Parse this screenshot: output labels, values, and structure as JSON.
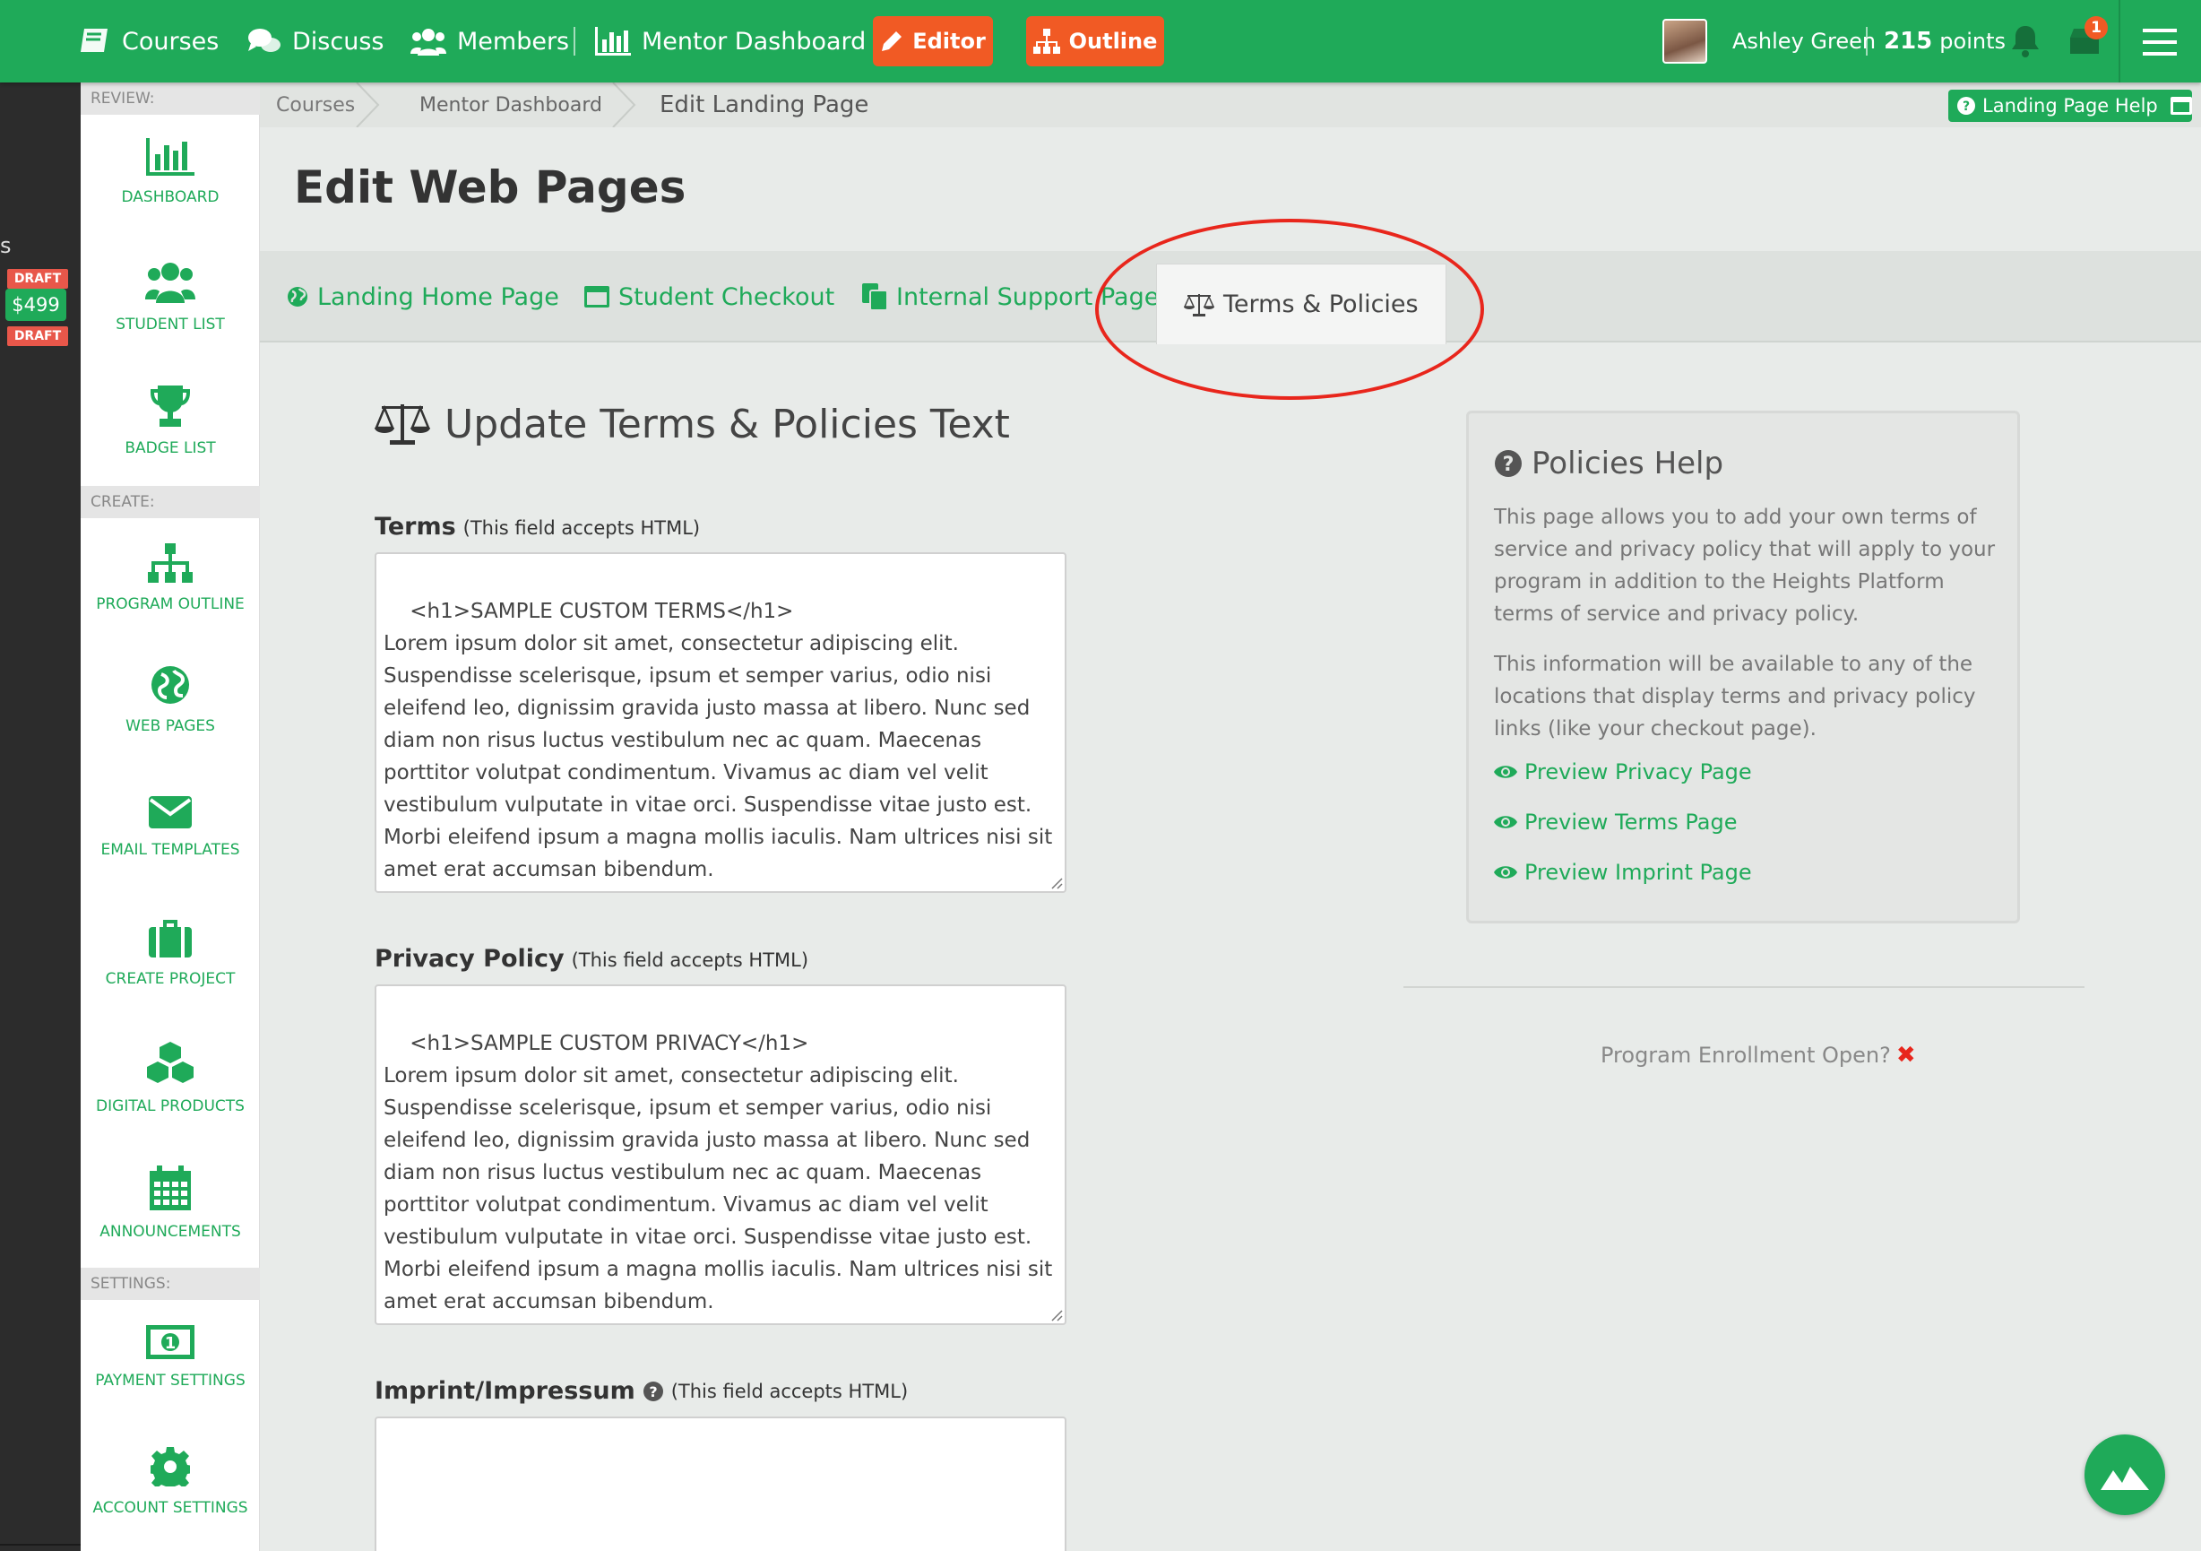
{
  "topnav": {
    "courses": "Courses",
    "discuss": "Discuss",
    "members": "Members",
    "mentor_dashboard": "Mentor Dashboard",
    "editor": "Editor",
    "outline": "Outline",
    "user_name": "Ashley Green",
    "points_value": "215",
    "points_label": "points",
    "notification_count": "1"
  },
  "darkside": {
    "partial_text": "s",
    "price": "$499",
    "draft1": "DRAFT",
    "draft2": "DRAFT"
  },
  "sidebar": {
    "review_heading": "REVIEW:",
    "create_heading": "CREATE:",
    "settings_heading": "SETTINGS:",
    "dashboard": "DASHBOARD",
    "student_list": "STUDENT LIST",
    "badge_list": "BADGE LIST",
    "program_outline": "PROGRAM OUTLINE",
    "web_pages": "WEB PAGES",
    "email_templates": "EMAIL TEMPLATES",
    "create_project": "CREATE PROJECT",
    "digital_products": "DIGITAL PRODUCTS",
    "announcements": "ANNOUNCEMENTS",
    "payment_settings": "PAYMENT SETTINGS",
    "account_settings": "ACCOUNT SETTINGS"
  },
  "breadcrumb": {
    "courses": "Courses",
    "mentor_dashboard": "Mentor Dashboard",
    "current": "Edit Landing Page",
    "help_button": "Landing Page Help"
  },
  "page": {
    "title": "Edit Web Pages"
  },
  "tabs": {
    "landing_home": "Landing Home Page",
    "student_checkout": "Student Checkout",
    "internal_support": "Internal Support Page",
    "terms_policies": "Terms & Policies"
  },
  "form": {
    "section_title": "Update Terms & Policies Text",
    "terms_label": "Terms",
    "privacy_label": "Privacy Policy",
    "imprint_label": "Imprint/Impressum",
    "html_note": "(This field accepts HTML)",
    "terms_value": "<h1>SAMPLE CUSTOM TERMS</h1>\nLorem ipsum dolor sit amet, consectetur adipiscing elit. Suspendisse scelerisque, ipsum et semper varius, odio nisi eleifend leo, dignissim gravida justo massa at libero. Nunc sed diam non risus luctus vestibulum nec ac quam. Maecenas porttitor volutpat condimentum. Vivamus ac diam vel velit vestibulum vulputate in vitae orci. Suspendisse vitae justo est. Morbi eleifend ipsum a magna mollis iaculis. Nam ultrices nisi sit amet erat accumsan bibendum.",
    "privacy_value": "<h1>SAMPLE CUSTOM PRIVACY</h1>\nLorem ipsum dolor sit amet, consectetur adipiscing elit. Suspendisse scelerisque, ipsum et semper varius, odio nisi eleifend leo, dignissim gravida justo massa at libero. Nunc sed diam non risus luctus vestibulum nec ac quam. Maecenas porttitor volutpat condimentum. Vivamus ac diam vel velit vestibulum vulputate in vitae orci. Suspendisse vitae justo est. Morbi eleifend ipsum a magna mollis iaculis. Nam ultrices nisi sit amet erat accumsan bibendum.",
    "imprint_value": ""
  },
  "help_panel": {
    "title": "Policies Help",
    "para1": "This page allows you to add your own terms of service and privacy policy that will apply to your program in addition to the Heights Platform terms of service and privacy policy.",
    "para2": "This information will be available to any of the locations that display terms and privacy policy links (like your checkout page).",
    "link_privacy": "Preview Privacy Page",
    "link_terms": "Preview Terms Page",
    "link_imprint": "Preview Imprint Page"
  },
  "enrollment": {
    "label": "Program Enrollment Open?",
    "status": "✖"
  },
  "colors": {
    "brand_green": "#1faa59",
    "accent_orange": "#f15a24",
    "annotation_red": "#e8261c"
  }
}
